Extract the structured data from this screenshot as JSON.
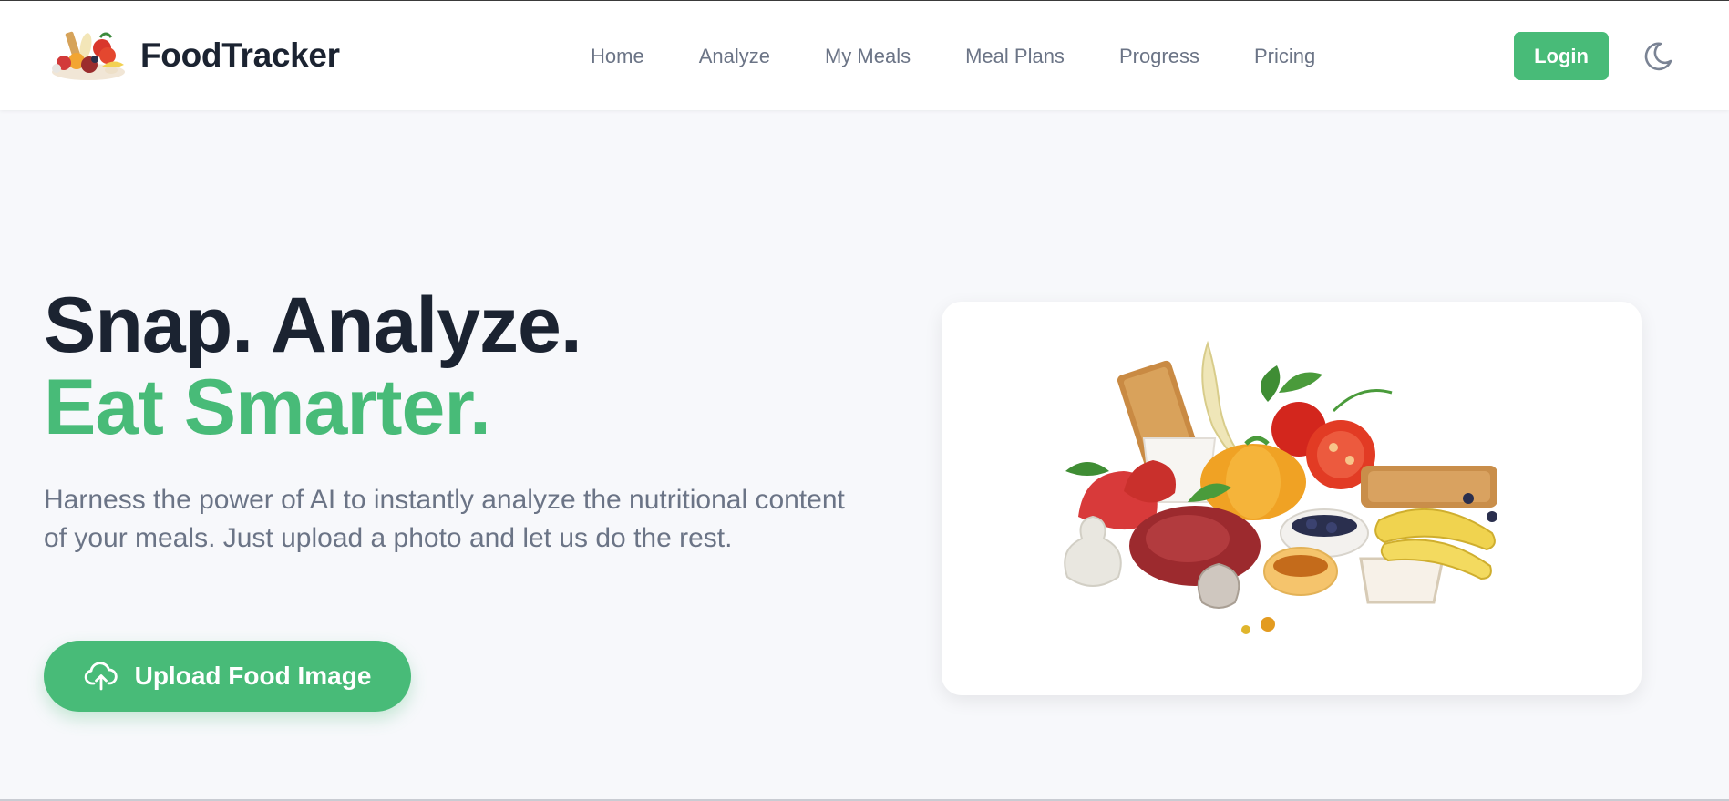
{
  "brand": {
    "name": "FoodTracker",
    "logo_icon": "food-collage-logo",
    "accent_color": "#48bb78",
    "text_color": "#1b2331",
    "muted_color": "#6b7486"
  },
  "nav": {
    "items": [
      {
        "label": "Home"
      },
      {
        "label": "Analyze"
      },
      {
        "label": "My Meals"
      },
      {
        "label": "Meal Plans"
      },
      {
        "label": "Progress"
      },
      {
        "label": "Pricing"
      }
    ]
  },
  "header": {
    "login_label": "Login",
    "theme_icon": "moon-icon"
  },
  "hero": {
    "title_line1": "Snap. Analyze.",
    "title_line2": "Eat Smarter.",
    "description": "Harness the power of AI to instantly analyze the nutritional content of your meals. Just upload a photo and let us do the rest.",
    "upload_label": "Upload Food Image",
    "upload_icon": "cloud-upload-icon",
    "image_icon": "healthy-food-illustration"
  }
}
